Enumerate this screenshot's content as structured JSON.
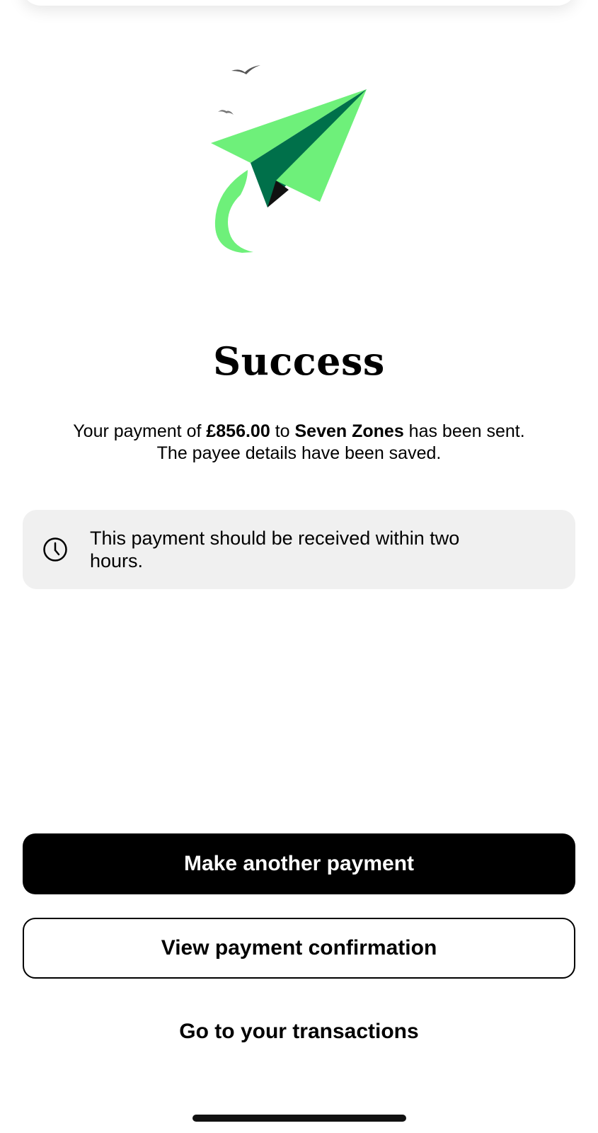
{
  "success": {
    "title": "Success",
    "message": {
      "prefix": "Your payment of ",
      "amount": "£856.00",
      "middle": " to ",
      "payee": "Seven Zones",
      "suffix": " has been sent.",
      "line2": "The payee details have been saved."
    },
    "info": {
      "icon": "clock-icon",
      "text": "This payment should be received within two hours."
    }
  },
  "actions": {
    "primary_label": "Make another payment",
    "secondary_label": "View payment confirmation",
    "link_label": "Go to your transactions"
  },
  "colors": {
    "plane_light": "#6ef07a",
    "plane_dark": "#00704a",
    "primary_button": "#000000",
    "info_background": "#f0f0f0"
  }
}
